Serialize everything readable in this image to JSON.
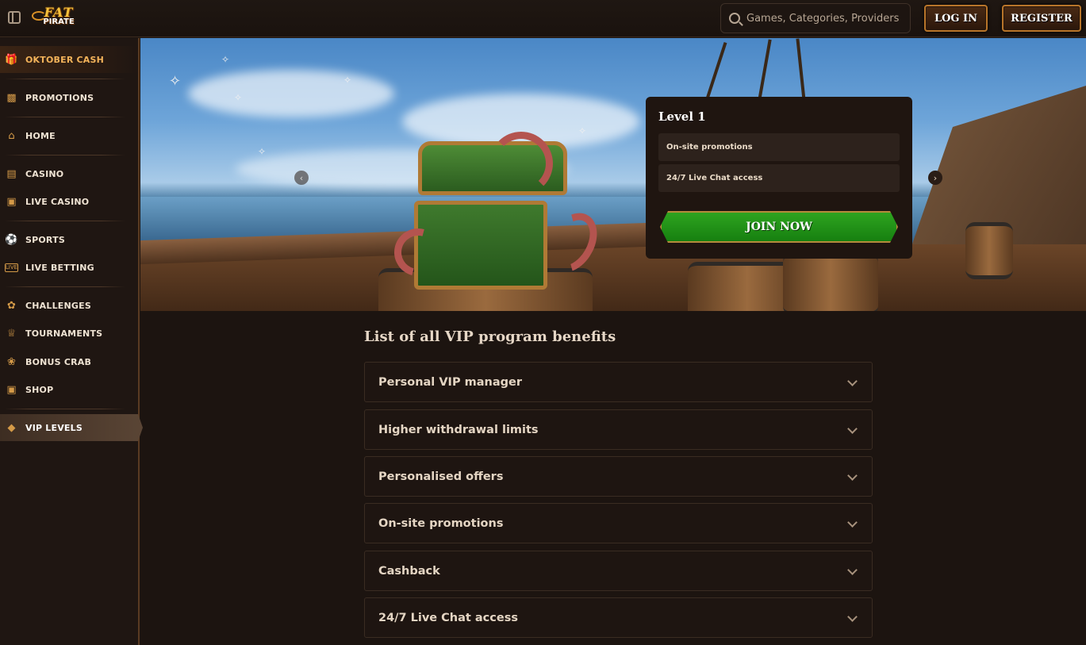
{
  "header": {
    "logo_line1": "FAT",
    "logo_line2": "PIRATE",
    "search_placeholder": "Games, Categories, Providers",
    "login_label": "LOG IN",
    "register_label": "REGISTER"
  },
  "sidebar": {
    "items": [
      {
        "label": "OKTOBER CASH",
        "icon": "gift-icon"
      },
      {
        "label": "PROMOTIONS",
        "icon": "promotions-icon"
      },
      {
        "label": "HOME",
        "icon": "home-icon"
      },
      {
        "label": "CASINO",
        "icon": "slot-machine-icon"
      },
      {
        "label": "LIVE CASINO",
        "icon": "card-icon"
      },
      {
        "label": "SPORTS",
        "icon": "soccer-ball-icon"
      },
      {
        "label": "LIVE BETTING",
        "icon": "live-icon"
      },
      {
        "label": "CHALLENGES",
        "icon": "medal-icon"
      },
      {
        "label": "TOURNAMENTS",
        "icon": "trophy-icon"
      },
      {
        "label": "BONUS CRAB",
        "icon": "crab-icon"
      },
      {
        "label": "SHOP",
        "icon": "bag-icon"
      },
      {
        "label": "VIP LEVELS",
        "icon": "diamond-icon"
      }
    ]
  },
  "hero": {
    "level_title": "Level 1",
    "benefits": [
      "On-site promotions",
      "24/7 Live Chat access"
    ],
    "join_label": "JOIN NOW"
  },
  "benefits_section": {
    "title": "List of all VIP program benefits",
    "items": [
      "Personal VIP manager",
      "Higher withdrawal limits",
      "Personalised offers",
      "On-site promotions",
      "Cashback",
      "24/7 Live Chat access"
    ]
  },
  "colors": {
    "background": "#1c1410",
    "accent_gold": "#d49a48",
    "join_green": "#1f9418"
  }
}
